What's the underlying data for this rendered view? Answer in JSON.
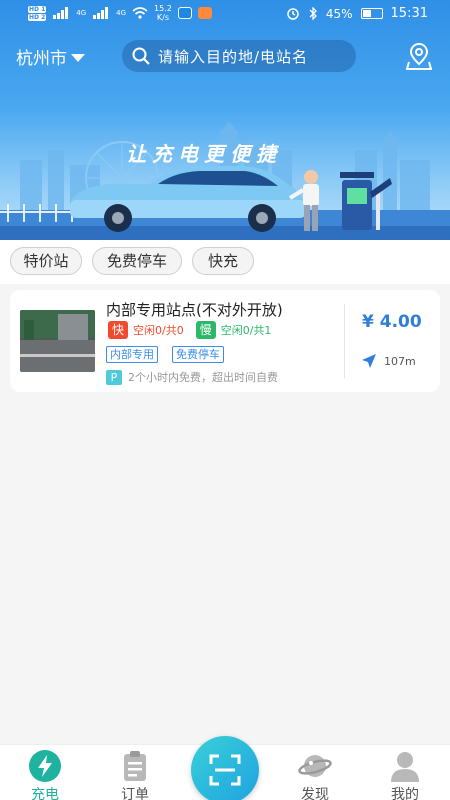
{
  "status_bar": {
    "hd1": "HD 1",
    "hd2": "HD 2",
    "net1": "4G",
    "net2": "4G",
    "net_speed_value": "15.2",
    "net_speed_unit": "K/s",
    "battery_percent": "45%",
    "battery_level": 0.45,
    "time": "15:31"
  },
  "header": {
    "city": "杭州市",
    "search_placeholder": "请输入目的地/电站名"
  },
  "banner": {
    "slogan": "让充电更便捷"
  },
  "filters": [
    "特价站",
    "免费停车",
    "快充"
  ],
  "station": {
    "name": "内部专用站点(不对外开放)",
    "fast_label": "快",
    "fast_status": "空闲0/共0",
    "slow_label": "慢",
    "slow_status": "空闲0/共1",
    "tags": [
      "内部专用",
      "免费停车"
    ],
    "parking_icon": "P",
    "parking_note": "2个小时内免费，超出时间自费",
    "price": "¥ 4.00",
    "distance": "107m"
  },
  "bottom_nav": {
    "items": [
      {
        "label": "充电",
        "icon": "bolt-icon",
        "active": true
      },
      {
        "label": "订单",
        "icon": "clipboard-icon",
        "active": false
      },
      {
        "label": "发现",
        "icon": "planet-icon",
        "active": false
      },
      {
        "label": "我的",
        "icon": "user-icon",
        "active": false
      }
    ],
    "scan_icon": "scan-icon"
  },
  "colors": {
    "accent": "#2f7ed8",
    "active_tab": "#1fb39f",
    "inactive_tab": "#555555",
    "fast_tag": "#f04b2c",
    "slow_tag": "#2bb86a",
    "outline_tag": "#3a8ee6"
  }
}
